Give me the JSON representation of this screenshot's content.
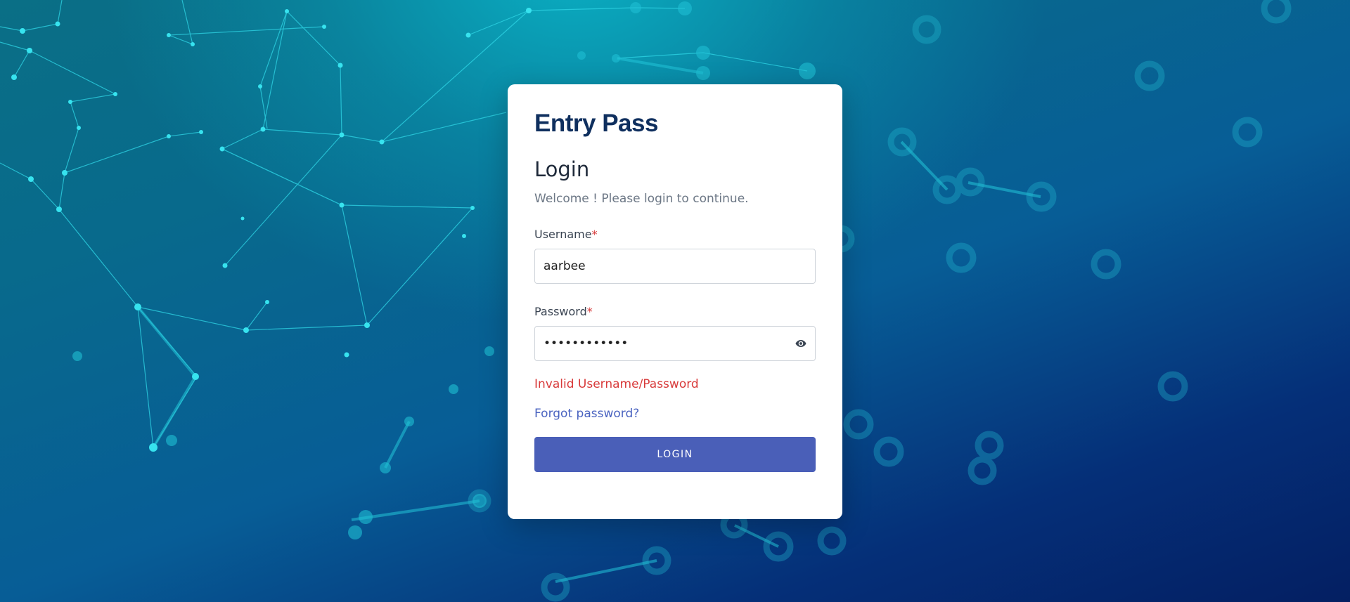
{
  "app": {
    "brand": "Entry Pass"
  },
  "login": {
    "heading": "Login",
    "subtext": "Welcome ! Please login to continue.",
    "username_label": "Username",
    "password_label": "Password",
    "required_mark": "*",
    "username_value": "aarbee",
    "password_value": "aarbee123456",
    "error_message": "Invalid Username/Password",
    "forgot_link": "Forgot password?",
    "submit_label": "LOGIN"
  },
  "icons": {
    "password_toggle": "eye-icon"
  },
  "colors": {
    "brand_text": "#0f2f5e",
    "button_bg": "#4a5fb8",
    "error_text": "#d83a3a",
    "link_text": "#4a63c0",
    "required_mark": "#d63a3a"
  }
}
